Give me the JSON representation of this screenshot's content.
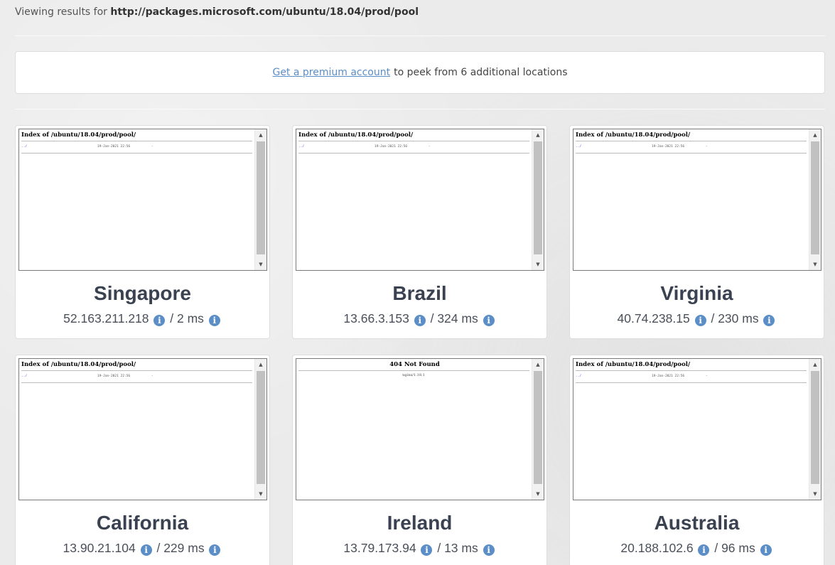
{
  "header": {
    "prefix": "Viewing results for",
    "url": "http://packages.microsoft.com/ubuntu/18.04/prod/pool"
  },
  "premium": {
    "link": "Get a premium account",
    "text": "to peek from 6 additional locations"
  },
  "icons": {
    "info": "info-circle-icon",
    "scroll_up": "scroll-up-arrow-icon",
    "scroll_down": "scroll-down-arrow-icon"
  },
  "colors": {
    "accent": "#5b8ec7",
    "background": "#ebebeb",
    "card": "#ffffff"
  },
  "locations": [
    {
      "city": "Singapore",
      "ip": "52.163.211.218",
      "latency": "2 ms",
      "page_title": "Index of /ubuntu/18.04/prod/pool/",
      "link": "../",
      "date": "19-Jan-2021 22:56",
      "dash": "-"
    },
    {
      "city": "Brazil",
      "ip": "13.66.3.153",
      "latency": "324 ms",
      "page_title": "Index of /ubuntu/18.04/prod/pool/",
      "link": "../",
      "date": "19-Jan-2021 22:56",
      "dash": "-"
    },
    {
      "city": "Virginia",
      "ip": "40.74.238.15",
      "latency": "230 ms",
      "page_title": "Index of /ubuntu/18.04/prod/pool/",
      "link": "../",
      "date": "19-Jan-2021 22:56",
      "dash": "-"
    },
    {
      "city": "California",
      "ip": "13.90.21.104",
      "latency": "229 ms",
      "page_title": "Index of /ubuntu/18.04/prod/pool/",
      "link": "../",
      "date": "19-Jan-2021 22:56",
      "dash": "-"
    },
    {
      "city": "Ireland",
      "ip": "13.79.173.94",
      "latency": "13 ms",
      "page_title": "404 Not Found",
      "server": "nginx/1.18.1"
    },
    {
      "city": "Australia",
      "ip": "20.188.102.6",
      "latency": "96 ms",
      "page_title": "Index of /ubuntu/18.04/prod/pool/",
      "link": "../",
      "date": "19-Jan-2021 22:56",
      "dash": "-"
    }
  ]
}
